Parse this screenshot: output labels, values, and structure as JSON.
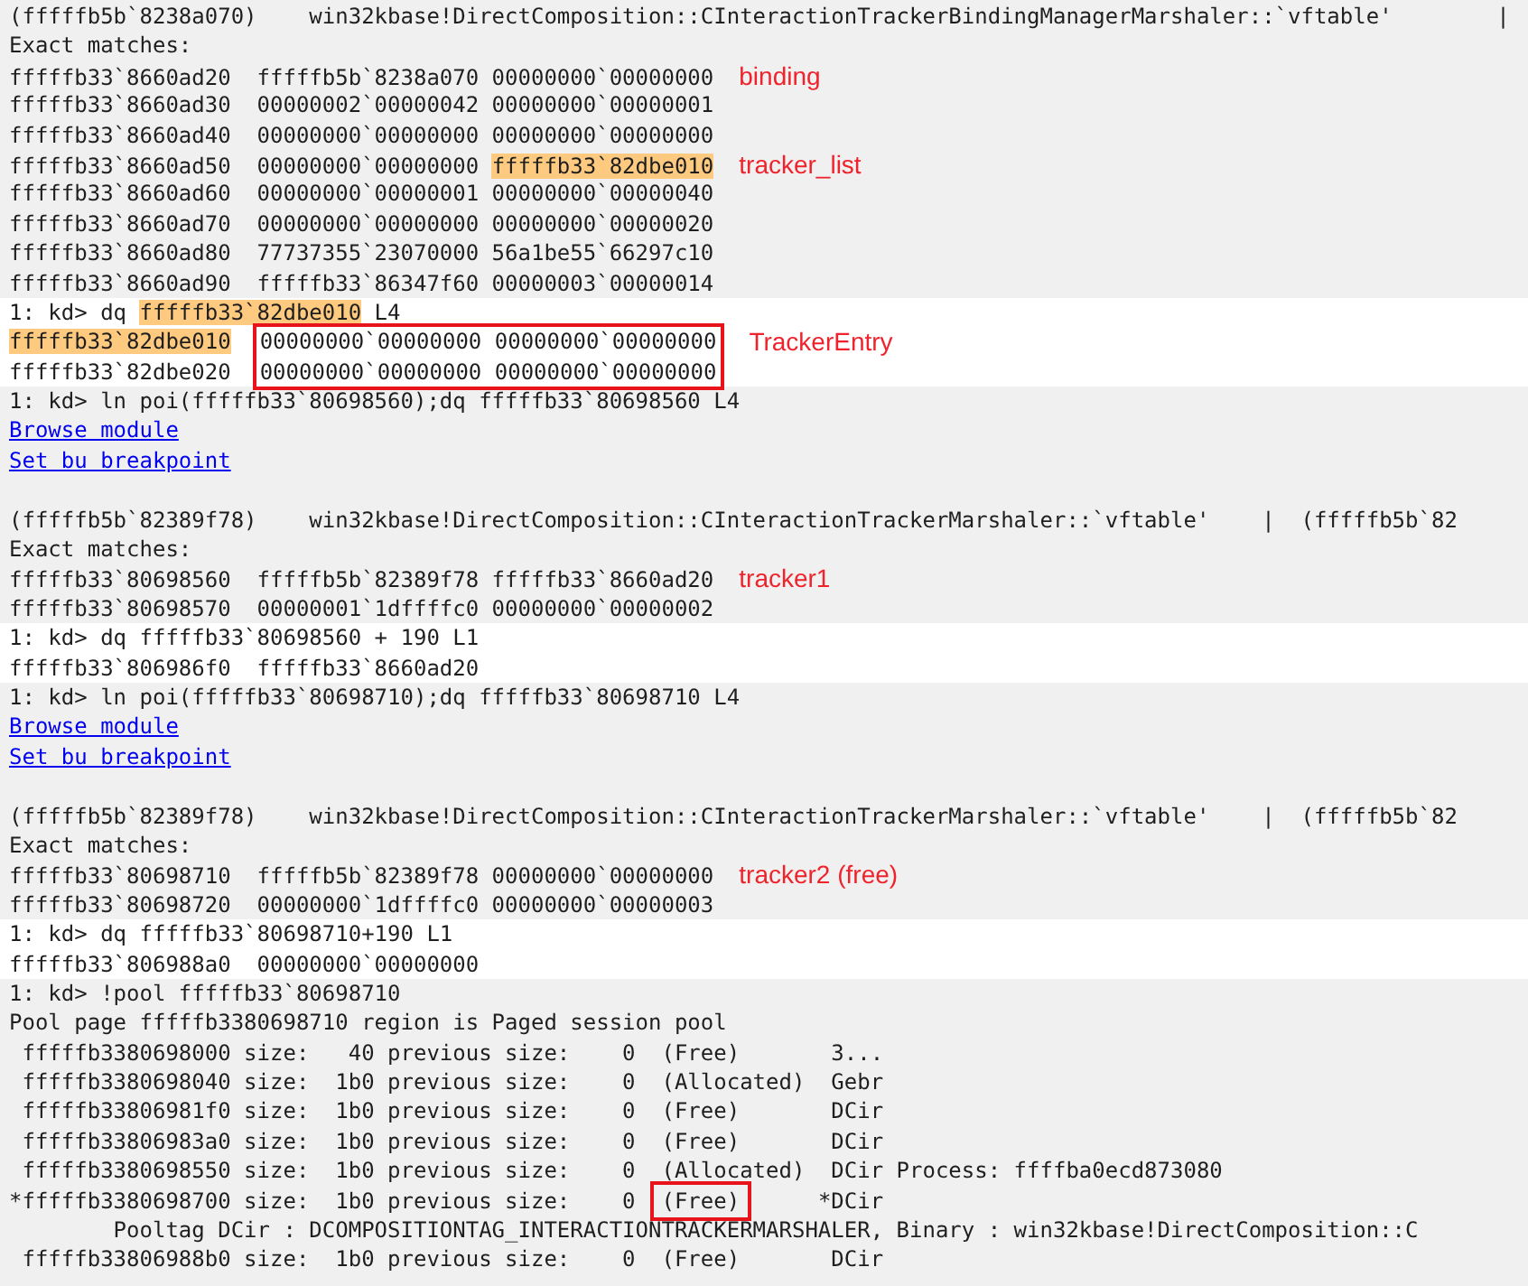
{
  "blocks": [
    {
      "highlighted": false,
      "lines": [
        {
          "kind": "text",
          "segments": [
            {
              "text": "(fffffb5b`8238a070)    win32kbase!DirectComposition::CInteractionTrackerBindingManagerMarshaler::`vftable'        |",
              "kind": "text"
            }
          ]
        },
        {
          "kind": "text",
          "segments": [
            {
              "text": "Exact matches:",
              "kind": "text"
            }
          ]
        },
        {
          "kind": "text",
          "segments": [
            {
              "text": "fffffb33`8660ad20  fffffb5b`8238a070 00000000`00000000",
              "kind": "text"
            }
          ],
          "note": "binding"
        },
        {
          "kind": "text",
          "segments": [
            {
              "text": "fffffb33`8660ad30  00000002`00000042 00000000`00000001",
              "kind": "text"
            }
          ]
        },
        {
          "kind": "text",
          "segments": [
            {
              "text": "fffffb33`8660ad40  00000000`00000000 00000000`00000000",
              "kind": "text"
            }
          ]
        },
        {
          "kind": "text",
          "segments": [
            {
              "text": "fffffb33`8660ad50  00000000`00000000 ",
              "kind": "text"
            },
            {
              "text": "fffffb33`82dbe010",
              "kind": "highlight"
            }
          ],
          "note": "tracker_list"
        },
        {
          "kind": "text",
          "segments": [
            {
              "text": "fffffb33`8660ad60  00000000`00000001 00000000`00000040",
              "kind": "text"
            }
          ]
        },
        {
          "kind": "text",
          "segments": [
            {
              "text": "fffffb33`8660ad70  00000000`00000000 00000000`00000020",
              "kind": "text"
            }
          ]
        },
        {
          "kind": "text",
          "segments": [
            {
              "text": "fffffb33`8660ad80  77737355`23070000 56a1be55`66297c10",
              "kind": "text"
            }
          ]
        },
        {
          "kind": "text",
          "segments": [
            {
              "text": "fffffb33`8660ad90  fffffb33`86347f60 00000003`00000014",
              "kind": "text"
            }
          ]
        }
      ]
    },
    {
      "highlighted": true,
      "lines": [
        {
          "kind": "text",
          "segments": [
            {
              "text": "1: kd> dq ",
              "kind": "text"
            },
            {
              "text": "fffffb33`82dbe010",
              "kind": "highlight"
            },
            {
              "text": " L4",
              "kind": "text"
            }
          ]
        },
        {
          "kind": "boxed_rows",
          "rows": [
            {
              "address": {
                "text": "fffffb33`82dbe010",
                "kind": "highlight"
              },
              "data": "00000000`00000000 00000000`00000000"
            },
            {
              "address": {
                "text": "fffffb33`82dbe020",
                "kind": "text"
              },
              "data": "00000000`00000000 00000000`00000000"
            }
          ],
          "note": "TrackerEntry"
        }
      ]
    },
    {
      "highlighted": false,
      "lines": [
        {
          "kind": "text",
          "segments": [
            {
              "text": "1: kd> ln poi(fffffb33`80698560);dq fffffb33`80698560 L4",
              "kind": "text"
            }
          ]
        },
        {
          "kind": "link",
          "text": "Browse module"
        },
        {
          "kind": "link",
          "text": "Set bu breakpoint"
        },
        {
          "kind": "blank"
        },
        {
          "kind": "text",
          "segments": [
            {
              "text": "(fffffb5b`82389f78)    win32kbase!DirectComposition::CInteractionTrackerMarshaler::`vftable'    |  (fffffb5b`82",
              "kind": "text"
            }
          ]
        },
        {
          "kind": "text",
          "segments": [
            {
              "text": "Exact matches:",
              "kind": "text"
            }
          ]
        },
        {
          "kind": "text",
          "segments": [
            {
              "text": "fffffb33`80698560  fffffb5b`82389f78 fffffb33`8660ad20",
              "kind": "text"
            }
          ],
          "note": "tracker1"
        },
        {
          "kind": "text",
          "segments": [
            {
              "text": "fffffb33`80698570  00000001`1dffffc0 00000000`00000002",
              "kind": "text"
            }
          ]
        }
      ]
    },
    {
      "highlighted": true,
      "lines": [
        {
          "kind": "text",
          "segments": [
            {
              "text": "1: kd> dq fffffb33`80698560 + 190 L1",
              "kind": "text"
            }
          ]
        },
        {
          "kind": "text",
          "segments": [
            {
              "text": "fffffb33`806986f0  fffffb33`8660ad20",
              "kind": "text"
            }
          ]
        }
      ]
    },
    {
      "highlighted": false,
      "lines": [
        {
          "kind": "text",
          "segments": [
            {
              "text": "1: kd> ln poi(fffffb33`80698710);dq fffffb33`80698710 L4",
              "kind": "text"
            }
          ]
        },
        {
          "kind": "link",
          "text": "Browse module"
        },
        {
          "kind": "link",
          "text": "Set bu breakpoint"
        },
        {
          "kind": "blank"
        },
        {
          "kind": "text",
          "segments": [
            {
              "text": "(fffffb5b`82389f78)    win32kbase!DirectComposition::CInteractionTrackerMarshaler::`vftable'    |  (fffffb5b`82",
              "kind": "text"
            }
          ]
        },
        {
          "kind": "text",
          "segments": [
            {
              "text": "Exact matches:",
              "kind": "text"
            }
          ]
        },
        {
          "kind": "text",
          "segments": [
            {
              "text": "fffffb33`80698710  fffffb5b`82389f78 00000000`00000000",
              "kind": "text"
            }
          ],
          "note": "tracker2 (free)"
        },
        {
          "kind": "text",
          "segments": [
            {
              "text": "fffffb33`80698720  00000000`1dffffc0 00000000`00000003",
              "kind": "text"
            }
          ]
        }
      ]
    },
    {
      "highlighted": true,
      "lines": [
        {
          "kind": "text",
          "segments": [
            {
              "text": "1: kd> dq fffffb33`80698710+190 L1",
              "kind": "text"
            }
          ]
        },
        {
          "kind": "text",
          "segments": [
            {
              "text": "fffffb33`806988a0  00000000`00000000",
              "kind": "text"
            }
          ]
        }
      ]
    },
    {
      "highlighted": false,
      "lines": [
        {
          "kind": "text",
          "segments": [
            {
              "text": "1: kd> !pool fffffb33`80698710",
              "kind": "text"
            }
          ]
        },
        {
          "kind": "text",
          "segments": [
            {
              "text": "Pool page fffffb3380698710 region is Paged session pool",
              "kind": "text"
            }
          ]
        },
        {
          "kind": "text",
          "segments": [
            {
              "text": " fffffb3380698000 size:   40 previous size:    0  (Free)       3...",
              "kind": "text"
            }
          ]
        },
        {
          "kind": "text",
          "segments": [
            {
              "text": " fffffb3380698040 size:  1b0 previous size:    0  (Allocated)  Gebr",
              "kind": "text"
            }
          ]
        },
        {
          "kind": "text",
          "segments": [
            {
              "text": " fffffb33806981f0 size:  1b0 previous size:    0  (Free)       DCir",
              "kind": "text"
            }
          ]
        },
        {
          "kind": "text",
          "segments": [
            {
              "text": " fffffb33806983a0 size:  1b0 previous size:    0  (Free)       DCir",
              "kind": "text"
            }
          ]
        },
        {
          "kind": "text",
          "segments": [
            {
              "text": " fffffb3380698550 size:  1b0 previous size:    0  (Allocated)  DCir Process: ffffba0ecd873080",
              "kind": "text"
            }
          ]
        },
        {
          "kind": "text",
          "segments": [
            {
              "text": "*fffffb3380698700 size:  1b0 previous size:    0  ",
              "kind": "text"
            },
            {
              "text": "(Free)",
              "kind": "boxed"
            },
            {
              "text": "      *DCir",
              "kind": "text"
            }
          ]
        },
        {
          "kind": "text",
          "segments": [
            {
              "text": "        Pooltag DCir : DCOMPOSITIONTAG_INTERACTIONTRACKERMARSHALER, Binary : win32kbase!DirectComposition::C",
              "kind": "text"
            }
          ]
        },
        {
          "kind": "text",
          "segments": [
            {
              "text": " fffffb33806988b0 size:  1b0 previous size:    0  (Free)       DCir",
              "kind": "text"
            }
          ]
        }
      ]
    }
  ]
}
